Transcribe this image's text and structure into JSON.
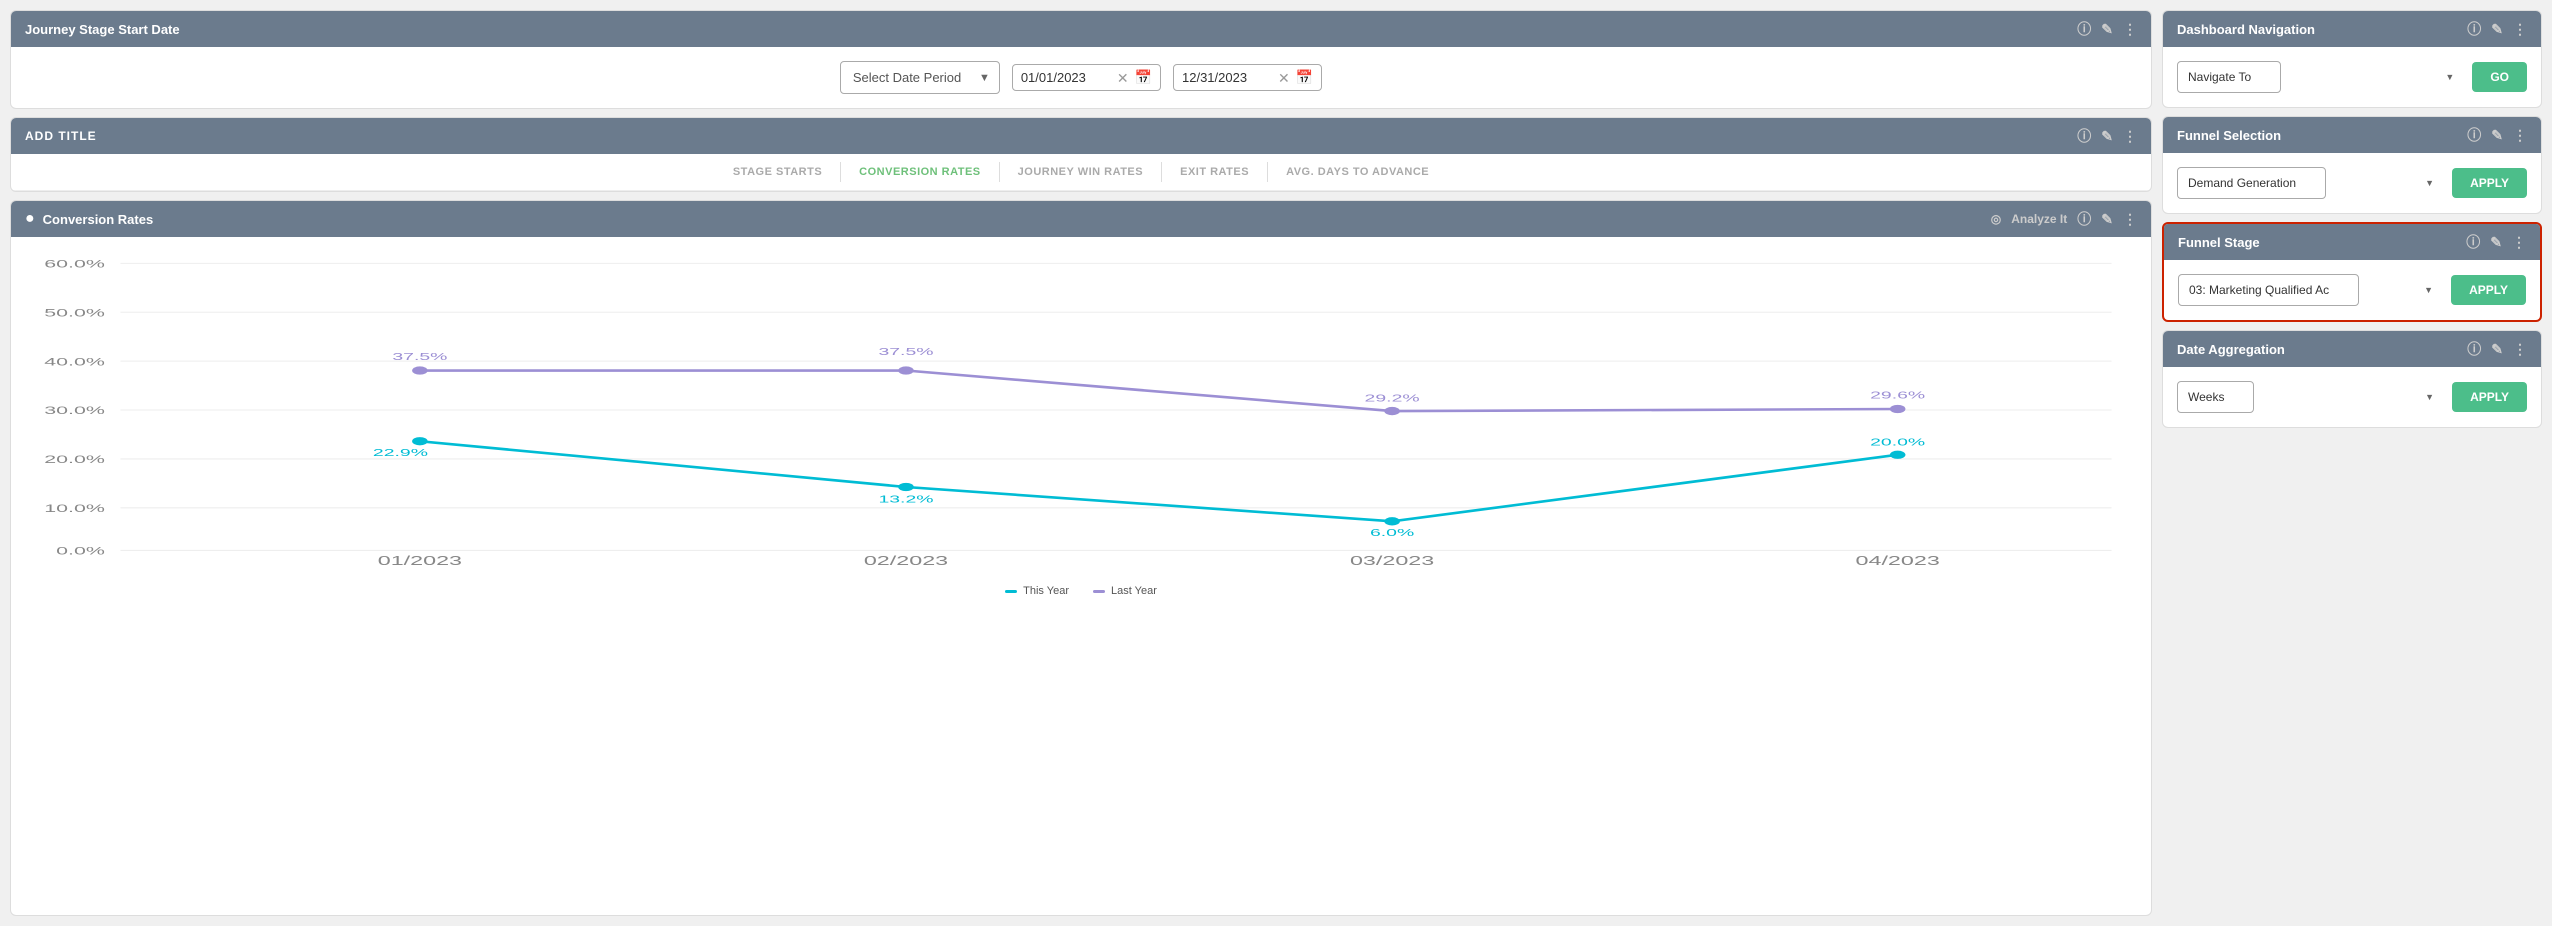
{
  "left": {
    "journey_card": {
      "title": "Journey Stage Start Date",
      "date_period_placeholder": "Select Date Period",
      "date_start": "01/01/2023",
      "date_end": "12/31/2023"
    },
    "add_title": "ADD TITLE",
    "tabs": [
      {
        "label": "STAGE STARTS",
        "active": false
      },
      {
        "label": "CONVERSION RATES",
        "active": true
      },
      {
        "label": "JOURNEY WIN RATES",
        "active": false
      },
      {
        "label": "EXIT RATES",
        "active": false
      },
      {
        "label": "AVG. DAYS TO ADVANCE",
        "active": false
      }
    ],
    "chart": {
      "title": "Conversion Rates",
      "analyze_label": "Analyze It",
      "y_labels": [
        "60.0%",
        "50.0%",
        "40.0%",
        "30.0%",
        "20.0%",
        "10.0%",
        "0.0%"
      ],
      "x_labels": [
        "01/2023",
        "02/2023",
        "03/2023",
        "04/2023"
      ],
      "this_year_points": [
        {
          "x": 0,
          "y": 22.9
        },
        {
          "x": 1,
          "y": 13.2
        },
        {
          "x": 2,
          "y": 6.0
        },
        {
          "x": 3,
          "y": 20.0
        }
      ],
      "last_year_points": [
        {
          "x": 0,
          "y": 37.5
        },
        {
          "x": 1,
          "y": 37.5
        },
        {
          "x": 2,
          "y": 29.2
        },
        {
          "x": 3,
          "y": 29.6
        }
      ],
      "this_year_color": "#00bcd4",
      "last_year_color": "#9c8fd4",
      "legend": {
        "this_year": "This Year",
        "last_year": "Last Year"
      }
    }
  },
  "right": {
    "dashboard_nav": {
      "title": "Dashboard Navigation",
      "navigate_label": "Navigate To",
      "go_label": "Go"
    },
    "funnel_selection": {
      "title": "Funnel Selection",
      "selected": "Demand Generation",
      "apply_label": "APPLY"
    },
    "funnel_stage": {
      "title": "Funnel Stage",
      "selected": "03: Marketing Qualified Ac",
      "apply_label": "APPLY"
    },
    "date_aggregation": {
      "title": "Date Aggregation",
      "selected": "Weeks",
      "apply_label": "Apply"
    }
  },
  "icons": {
    "info": "ⓘ",
    "edit": "✎",
    "more": "⋮",
    "analyze": "◎",
    "clear": "✕",
    "calendar": "📅",
    "chevron_down": "▼"
  }
}
